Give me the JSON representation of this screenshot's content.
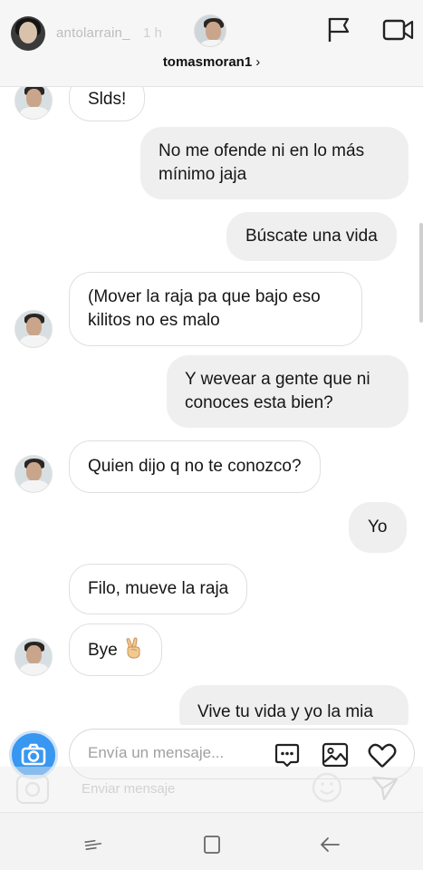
{
  "story": {
    "username": "antolarrain_",
    "time": "1 h",
    "reply_placeholder": "Enviar mensaje"
  },
  "chat": {
    "title": "tomasmoran1",
    "chevron": "›"
  },
  "messages": [
    {
      "side": "in",
      "text": "Slds!"
    },
    {
      "side": "out",
      "text": "No me ofende ni en lo más mínimo jaja"
    },
    {
      "side": "out",
      "text": "Búscate una vida"
    },
    {
      "side": "in",
      "text": "(Mover la raja pa que bajo eso kilitos no es malo"
    },
    {
      "side": "out",
      "text": "Y wevear a gente que ni conoces esta bien?"
    },
    {
      "side": "in",
      "text": "Quien dijo q no te conozco?"
    },
    {
      "side": "out",
      "text": "Yo"
    },
    {
      "side": "in",
      "text": "Filo, mueve la raja"
    },
    {
      "side": "in",
      "text": "Bye",
      "emoji": "victory-hand"
    },
    {
      "side": "out",
      "text": "Vive tu vida y yo la mia"
    }
  ],
  "composer": {
    "placeholder": "Envía un mensaje..."
  },
  "icons": {
    "flag": "flag-icon",
    "video": "video-camera-icon",
    "camera": "camera-icon",
    "gif": "chat-bubble-dots-icon",
    "gallery": "image-icon",
    "heart": "heart-icon",
    "send": "paper-plane-icon",
    "smile": "smiley-icon"
  },
  "colors": {
    "accent": "#3897f0",
    "incoming_bubble": "#ffffff",
    "outgoing_bubble": "#efefef"
  }
}
